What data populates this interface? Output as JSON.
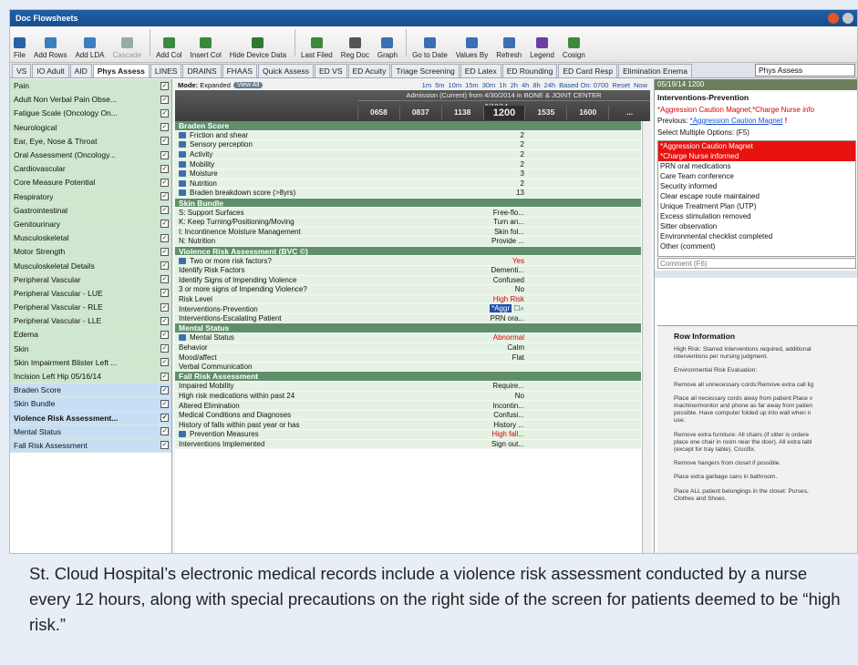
{
  "window": {
    "title": "Doc Flowsheets"
  },
  "toolbar": [
    {
      "label": "File"
    },
    {
      "label": "Add Rows"
    },
    {
      "label": "Add LDA"
    },
    {
      "label": "Cascade",
      "disabled": true
    },
    {
      "label": "Add Col"
    },
    {
      "label": "Insert Col"
    },
    {
      "label": "Hide Device Data"
    },
    {
      "label": "Last Filed"
    },
    {
      "label": "Reg Doc"
    },
    {
      "label": "Graph"
    },
    {
      "label": "Go to Date"
    },
    {
      "label": "Values By"
    },
    {
      "label": "Refresh"
    },
    {
      "label": "Legend"
    },
    {
      "label": "Cosign"
    }
  ],
  "tabs": [
    "VS",
    "IO Adult",
    "AID",
    "Phys Assess",
    "LINES",
    "DRAINS",
    "FHAAS",
    "Quick Assess",
    "ED VS",
    "ED Acuity",
    "Triage Screening",
    "ED Latex",
    "ED Rounding",
    "ED Card Resp",
    "Elimination Enema"
  ],
  "active_tab": "Phys Assess",
  "phys_select": "Phys Assess",
  "left_items": [
    "Pain",
    "Adult Non Verbal Pain Obse...",
    "Fatigue Scale (Oncology On...",
    "Neurological",
    "Ear, Eye, Nose & Throat",
    "Oral Assessment (Oncology...",
    "Cardiovascular",
    "Core Measure Potential",
    "Respiratory",
    "Gastrointestinal",
    "Genitourinary",
    "Musculoskeletal",
    "Motor Strength",
    "Musculoskeletal Details",
    "Peripheral Vascular",
    "Peripheral Vascular - LUE",
    "Peripheral Vascular - RLE",
    "Peripheral Vascular - LLE",
    "Edema",
    "Skin",
    "Skin Impairment Blister Left ...",
    "Incision  Left Hip 05/16/14",
    "Braden Score",
    "Skin Bundle",
    "Violence Risk Assessment...",
    "Mental Status",
    "Fall Risk Assessment"
  ],
  "mode": {
    "label": "Mode:",
    "value": "Expanded",
    "pill": "View All",
    "intervals": [
      "1m",
      "5m",
      "10m",
      "15m",
      "30m",
      "1h",
      "2h",
      "4h",
      "8h",
      "24h",
      "Based On: 0700",
      "Reset",
      "Now"
    ]
  },
  "grid": {
    "admission": "Admission (Current) from 4/30/2014 in BONE & JOINT CENTER",
    "date": "5/19/14",
    "columns": [
      "0658",
      "0837",
      "1138",
      "1200",
      "1535",
      "1600",
      "..."
    ]
  },
  "rows": [
    {
      "type": "sec",
      "label": "Braden Score"
    },
    {
      "label": "Friction and shear",
      "value": "2",
      "icon": true
    },
    {
      "label": "Sensory perception",
      "value": "2",
      "icon": true
    },
    {
      "label": "Activity",
      "value": "2",
      "icon": true
    },
    {
      "label": "Mobility",
      "value": "2",
      "icon": true
    },
    {
      "label": "Moisture",
      "value": "3",
      "icon": true
    },
    {
      "label": "Nutrition",
      "value": "2",
      "icon": true
    },
    {
      "label": "Braden breakdown score (>8yrs)",
      "value": "13",
      "icon": true
    },
    {
      "type": "sec",
      "label": "Skin Bundle"
    },
    {
      "label": "S: Support Surfaces",
      "value": "Free-flo..."
    },
    {
      "label": "K: Keep Turning/Positioning/Moving",
      "value": "Turn an..."
    },
    {
      "label": "I: Incontinence Moisture Management",
      "value": "Skin fol..."
    },
    {
      "label": "N: Nutrition",
      "value": "Provide ..."
    },
    {
      "type": "sec",
      "label": "Violence Risk Assessment (BVC ©)"
    },
    {
      "label": "Two or more risk factors?",
      "value": "Yes",
      "red": true,
      "icon": true
    },
    {
      "label": "Identify Risk Factors",
      "value": "Dementi..."
    },
    {
      "label": "Identify Signs of Impending Violence",
      "value": "Confused"
    },
    {
      "label": "3 or more signs of Impending Violence?",
      "value": "No"
    },
    {
      "label": "Risk Level",
      "value": "High Risk",
      "red": true
    },
    {
      "label": "Interventions-Prevention",
      "value": "*Aggr",
      "editing": true
    },
    {
      "label": "Interventions-Escalating Patient",
      "value": "PRN ora..."
    },
    {
      "type": "sec",
      "label": "Mental Status"
    },
    {
      "label": "Mental Status",
      "value": "Abnormal",
      "red": true,
      "icon": true
    },
    {
      "label": "Behavior",
      "value": "Calm"
    },
    {
      "label": "Mood/affect",
      "value": "Flat"
    },
    {
      "label": "Verbal Communication",
      "value": ""
    },
    {
      "type": "sec",
      "label": "Fall Risk Assessment"
    },
    {
      "label": "Impaired Mobility",
      "value": "Require..."
    },
    {
      "label": "High risk medications within past 24",
      "value": "No"
    },
    {
      "label": "Altered Elimination",
      "value": "Incontin..."
    },
    {
      "label": "Medical Conditions and Diagnoses",
      "value": "Confusi..."
    },
    {
      "label": "History of falls within past year or has",
      "value": "History ..."
    },
    {
      "label": "Prevention Measures",
      "value": "High fall...",
      "red": true,
      "icon": true
    },
    {
      "label": "Interventions Implemented",
      "value": "Sign out..."
    }
  ],
  "right": {
    "header": "05/19/14 1200",
    "title": "Interventions-Prevention",
    "current": "*Aggression Caution Magnet;*Charge Nurse info",
    "previous_label": "Previous:",
    "previous_value": "*Aggression Caution Magnet",
    "select_label": "Select Multiple Options: (F5)",
    "options": [
      "*Aggression Caution Magnet",
      "*Charge Nurse informed",
      "PRN oral medications",
      "Care Team conference",
      "Security informed",
      "Clear escape route maintained",
      "Unique Treatment Plan (UTP)",
      "Excess stimulation removed",
      "Sitter observation",
      "Environmental checklist completed",
      "Other (comment)"
    ],
    "highlighted": 2,
    "comment_placeholder": "Comment (F6)"
  },
  "row_info": {
    "title": "Row Information",
    "lines": [
      "High Risk: Starred interventions required, additional",
      "interventions per nursing judgment.",
      "Environmental Risk Evaluation:",
      "Remove all unnecessary cords:Remove extra call lig",
      "Place all necessary cords away from patient:Place v",
      "machine/monitor and phone as far away from patien",
      "possible. Have computer folded up into wall when n",
      "use.",
      "Remove extra furniture: All chairs (if sitter is ordere",
      "place one chair in room near the door). All extra tabl",
      "(except for tray table). Crucifix.",
      "Remove hangers from closet if possible.",
      "Place extra garbage cans in bathroom.",
      "Place ALL patient belongings in the closet: Purses,",
      "Clothes and Shoes."
    ]
  },
  "caption": "St. Cloud Hospital’s electronic medical records include a violence risk assessment conducted by a nurse every 12 hours, along with special precautions on the right side of the screen for patients deemed to be “high risk.”",
  "colors": {
    "title_bar": "#1f5fa8",
    "left_green": "#cfe6cf",
    "section_green": "#5f8f6a",
    "row_green": "#e5f2e3",
    "highlight_red": "#e8120f"
  }
}
